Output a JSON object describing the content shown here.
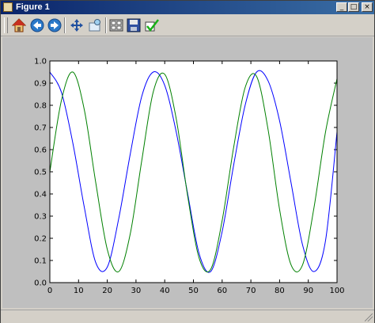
{
  "window": {
    "title": "Figure 1"
  },
  "window_controls": {
    "minimize": "_",
    "maximize": "□",
    "close": "×"
  },
  "toolbar": {
    "buttons": [
      {
        "icon": "home-icon"
      },
      {
        "icon": "back-arrow-icon"
      },
      {
        "icon": "forward-arrow-icon"
      },
      {
        "icon": "pan-icon"
      },
      {
        "icon": "zoom-rect-icon"
      },
      {
        "icon": "subplots-icon"
      },
      {
        "icon": "save-icon"
      },
      {
        "icon": "checkmark-icon"
      }
    ]
  },
  "colors": {
    "figure_bg": "#bfbfbf",
    "axes_bg": "#ffffff",
    "series_blue": "#0000ff",
    "series_green": "#008000"
  },
  "chart_data": {
    "type": "line",
    "xlim": [
      0,
      100
    ],
    "ylim": [
      0.0,
      1.0
    ],
    "xticks": [
      0,
      10,
      20,
      30,
      40,
      50,
      60,
      70,
      80,
      90,
      100
    ],
    "yticks": [
      0.0,
      0.1,
      0.2,
      0.3,
      0.4,
      0.5,
      0.6,
      0.7,
      0.8,
      0.9,
      1.0
    ],
    "xtick_labels": [
      "0",
      "10",
      "20",
      "30",
      "40",
      "50",
      "60",
      "70",
      "80",
      "90",
      "100"
    ],
    "ytick_labels": [
      "0.0",
      "0.1",
      "0.2",
      "0.3",
      "0.4",
      "0.5",
      "0.6",
      "0.7",
      "0.8",
      "0.9",
      "1.0"
    ],
    "grid": false,
    "series": [
      {
        "color": "#0000ff",
        "x": [
          0,
          4,
          8,
          12,
          16,
          20,
          24,
          28,
          32,
          36,
          40,
          44,
          48,
          52,
          56,
          60,
          64,
          68,
          72,
          76,
          80,
          84,
          88,
          92,
          96,
          100
        ],
        "y": [
          0.95,
          0.86,
          0.63,
          0.34,
          0.09,
          0.07,
          0.29,
          0.58,
          0.84,
          0.95,
          0.89,
          0.68,
          0.4,
          0.13,
          0.05,
          0.23,
          0.53,
          0.8,
          0.95,
          0.91,
          0.73,
          0.45,
          0.17,
          0.05,
          0.19,
          0.68
        ]
      },
      {
        "color": "#008000",
        "x": [
          0,
          4,
          8,
          12,
          16,
          20,
          24,
          28,
          32,
          36,
          40,
          44,
          48,
          52,
          56,
          60,
          64,
          68,
          72,
          76,
          80,
          84,
          88,
          92,
          96,
          100
        ],
        "y": [
          0.5,
          0.82,
          0.95,
          0.78,
          0.45,
          0.15,
          0.05,
          0.22,
          0.55,
          0.86,
          0.94,
          0.74,
          0.39,
          0.11,
          0.06,
          0.28,
          0.61,
          0.88,
          0.93,
          0.69,
          0.33,
          0.08,
          0.08,
          0.34,
          0.68,
          0.92
        ]
      }
    ]
  }
}
